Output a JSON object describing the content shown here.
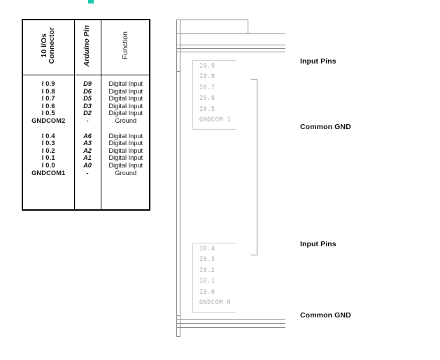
{
  "artifact": {
    "color": "#16c8b0",
    "name": "teal-marker"
  },
  "table": {
    "headers": {
      "connector": "10 I/Os\nConnector",
      "arduino_pin": "Arduino Pin",
      "function": "Function"
    },
    "groups": [
      {
        "rows": [
          {
            "connector": "I 0.9",
            "arduino_pin": "D9",
            "function": "Digital Input"
          },
          {
            "connector": "I 0.8",
            "arduino_pin": "D6",
            "function": "Digital Input"
          },
          {
            "connector": "I 0.7",
            "arduino_pin": "D5",
            "function": "Digital Input"
          },
          {
            "connector": "I 0.6",
            "arduino_pin": "D3",
            "function": "Digital Input"
          },
          {
            "connector": "I 0.5",
            "arduino_pin": "D2",
            "function": "Digital Input"
          },
          {
            "connector": "GNDCOM2",
            "arduino_pin": "-",
            "function": "Ground"
          }
        ]
      },
      {
        "rows": [
          {
            "connector": "I 0.4",
            "arduino_pin": "A6",
            "function": "Digital Input"
          },
          {
            "connector": "I 0.3",
            "arduino_pin": "A3",
            "function": "Digital Input"
          },
          {
            "connector": "I 0.2",
            "arduino_pin": "A2",
            "function": "Digital Input"
          },
          {
            "connector": "I 0.1",
            "arduino_pin": "A1",
            "function": "Digital Input"
          },
          {
            "connector": "I 0.0",
            "arduino_pin": "A0",
            "function": "Digital Input"
          },
          {
            "connector": "GNDCOM1",
            "arduino_pin": "-",
            "function": "Ground"
          }
        ]
      }
    ],
    "column_text": {
      "connector": "I 0.9\nI 0.8\nI 0.7\nI 0.6\nI 0.5\nGNDCOM2\n \nI 0.4\nI 0.3\nI 0.2\nI 0.1\nI 0.0\nGNDCOM1",
      "arduino_pin": "D9\nD6\nD5\nD3\nD2\n-\n \nA6\nA3\nA2\nA1\nA0\n-",
      "function": "Digital Input\nDigital Input\nDigital Input\nDigital Input\nDigital Input\nGround\n \nDigital Input\nDigital Input\nDigital Input\nDigital Input\nDigital Input\nGround"
    }
  },
  "drawing": {
    "line_color": "#8a8a8a",
    "pin_text_color": "#a8a8a8",
    "top_connector": {
      "lines": [
        "I0.9",
        "I0.8",
        "I0.7",
        "I0.6",
        "I0.5",
        "GNDCOM 1"
      ],
      "text": "I0.9\nI0.8\nI0.7\nI0.6\nI0.5\nGNDCOM 1"
    },
    "bottom_connector": {
      "lines": [
        "I0.4",
        "I0.3",
        "I0.2",
        "I0.1",
        "I0.0",
        "GNDCOM 0"
      ],
      "text": "I0.4\nI0.3\nI0.2\nI0.1\nI0.0\nGNDCOM 0"
    }
  },
  "annotations": {
    "input_pins_top": "Input Pins",
    "common_gnd_top": "Common GND",
    "input_pins_bottom": "Input Pins",
    "common_gnd_bottom": "Common GND"
  }
}
